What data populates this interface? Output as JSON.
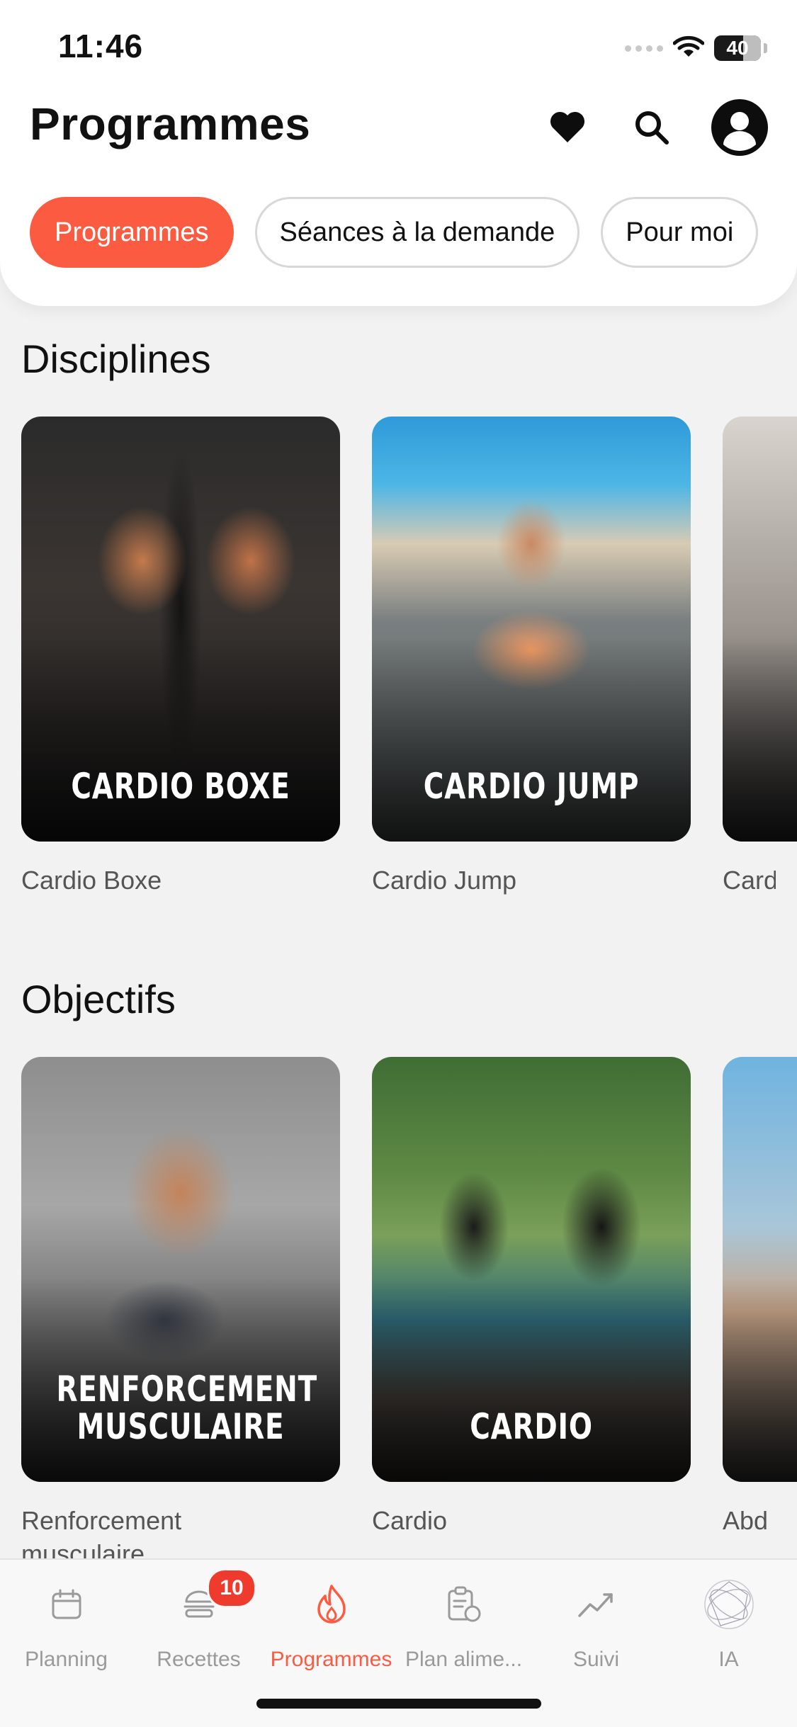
{
  "status_bar": {
    "time": "11:46",
    "battery": "40"
  },
  "header": {
    "title": "Programmes",
    "icons": {
      "favorites": "heart-icon",
      "search": "search-icon",
      "profile": "user-icon"
    }
  },
  "chips": [
    {
      "label": "Programmes",
      "active": true
    },
    {
      "label": "Séances à la demande",
      "active": false
    },
    {
      "label": "Pour moi",
      "active": false
    }
  ],
  "sections": {
    "disciplines": {
      "title": "Disciplines",
      "cards": [
        {
          "overlay": "CARDIO BOXE",
          "caption": "Cardio Boxe"
        },
        {
          "overlay": "CARDIO JUMP",
          "caption": "Cardio Jump"
        },
        {
          "overlay": "",
          "caption": "Card"
        }
      ]
    },
    "objectifs": {
      "title": "Objectifs",
      "cards": [
        {
          "overlay": "RENFORCEMENT\nMUSCULAIRE",
          "caption": "Renforcement\nmusculaire"
        },
        {
          "overlay": "CARDIO",
          "caption": "Cardio"
        },
        {
          "overlay": "",
          "caption": "Abd"
        }
      ]
    }
  },
  "tabbar": {
    "tabs": [
      {
        "label": "Planning",
        "icon": "calendar-icon",
        "active": false
      },
      {
        "label": "Recettes",
        "icon": "burger-icon",
        "active": false,
        "badge": "10"
      },
      {
        "label": "Programmes",
        "icon": "flame-icon",
        "active": true
      },
      {
        "label": "Plan alime...",
        "icon": "meal-plan-icon",
        "active": false
      },
      {
        "label": "Suivi",
        "icon": "trend-icon",
        "active": false
      },
      {
        "label": "IA",
        "icon": "ai-orb-icon",
        "active": false
      }
    ]
  },
  "colors": {
    "accent": "#fb5b40",
    "badge": "#ef3b2d",
    "background": "#f2f2f2"
  }
}
